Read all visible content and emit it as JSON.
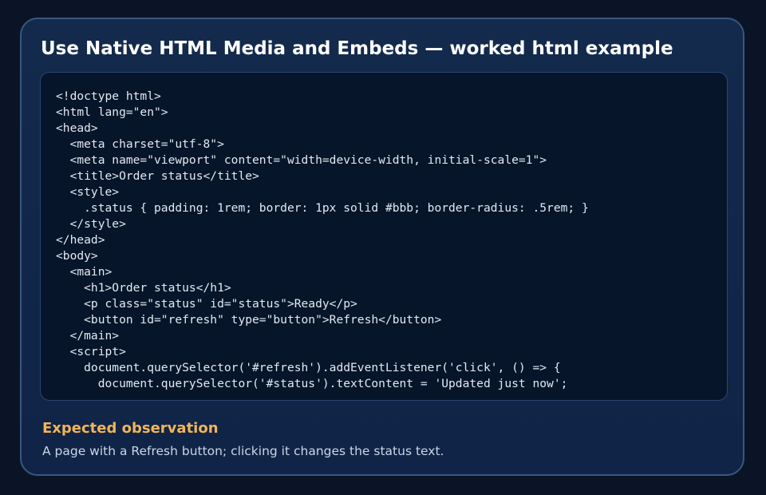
{
  "card": {
    "title": "Use Native HTML Media and Embeds — worked html example"
  },
  "code": {
    "lines": [
      "<!doctype html>",
      "<html lang=\"en\">",
      "<head>",
      "  <meta charset=\"utf-8\">",
      "  <meta name=\"viewport\" content=\"width=device-width, initial-scale=1\">",
      "  <title>Order status</title>",
      "  <style>",
      "    .status { padding: 1rem; border: 1px solid #bbb; border-radius: .5rem; }",
      "  </style>",
      "</head>",
      "<body>",
      "  <main>",
      "    <h1>Order status</h1>",
      "    <p class=\"status\" id=\"status\">Ready</p>",
      "    <button id=\"refresh\" type=\"button\">Refresh</button>",
      "  </main>",
      "  <script>",
      "    document.querySelector('#refresh').addEventListener('click', () => {",
      "      document.querySelector('#status').textContent = 'Updated just now';"
    ]
  },
  "observation": {
    "heading": "Expected observation",
    "text": "A page with a Refresh button; clicking it changes the status text."
  },
  "colors": {
    "background": "#0b1426",
    "card_border": "#3a5680",
    "code_background": "#061529",
    "heading_accent": "#f2b45a"
  }
}
